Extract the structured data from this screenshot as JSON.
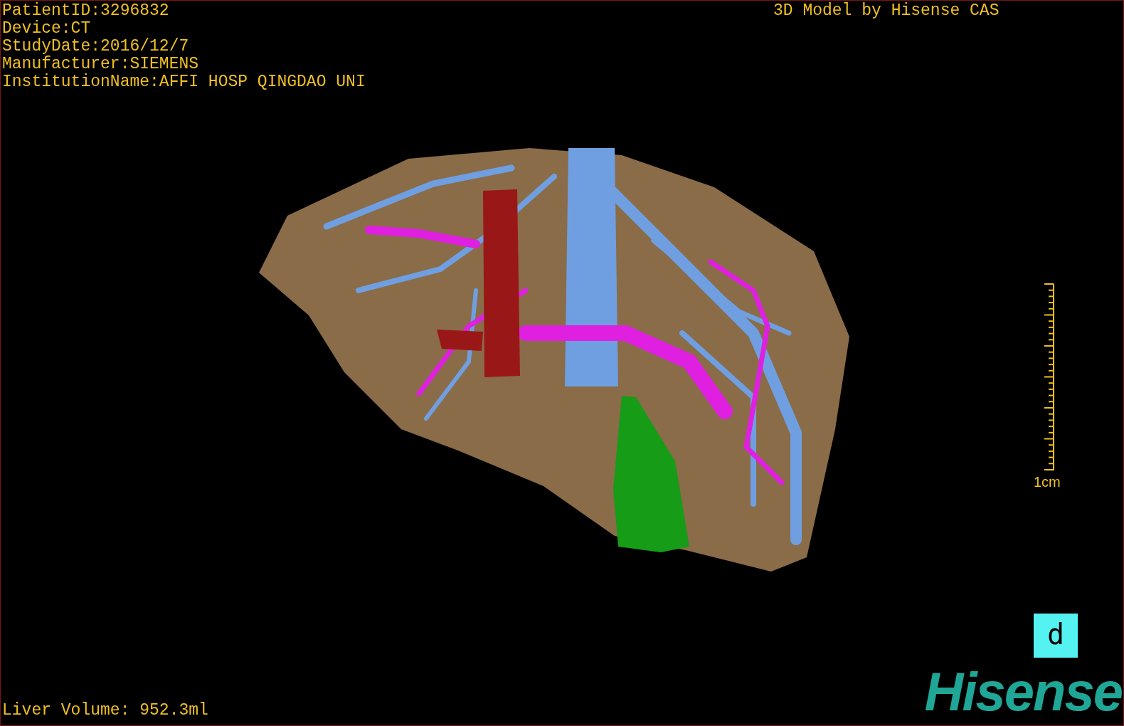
{
  "study_info": [
    "PatientID:3296832",
    "Device:CT",
    "StudyDate:2016/12/7",
    "Manufacturer:SIEMENS",
    "InstitutionName:AFFI HOSP QINGDAO UNI"
  ],
  "title": "3D Model by Hisense CAS",
  "scale_bar": {
    "label": "1cm"
  },
  "orientation": {
    "label": "d"
  },
  "liver_volume": "Liver Volume: 952.3ml",
  "logo": "Hisense"
}
